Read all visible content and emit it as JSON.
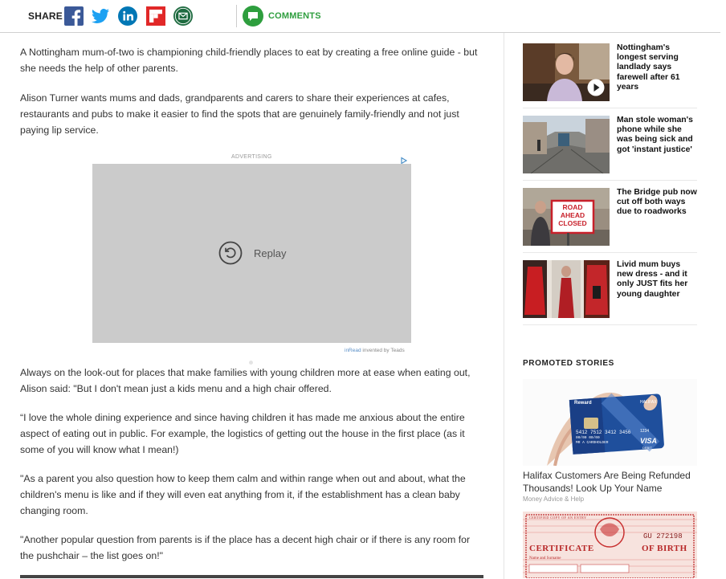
{
  "share": {
    "label": "SHARE",
    "icons": [
      "facebook-icon",
      "twitter-icon",
      "linkedin-icon",
      "flipboard-icon",
      "email-icon"
    ],
    "comments_label": "COMMENTS"
  },
  "article": {
    "paragraphs": [
      "A Nottingham mum-of-two is championing child-friendly places to eat by creating a free online guide - but she needs the help of other parents.",
      "Alison Turner wants mums and dads, grandparents and carers to share their experiences at cafes, restaurants and pubs to make it easier to find the spots that are genuinely family-friendly and not just paying lip service.",
      "Always on the look-out for places that make families with young children more at ease when eating out, Alison said: \"But I don't mean just a kids menu and a high chair offered.",
      "“I love the whole dining experience and since having children it has made me anxious about the entire aspect of eating out in public. For example, the logistics of getting out the house in the first place (as it some of you will know what I mean!)",
      "\"As a parent you also question how to keep them calm and within range when out and about, what the children's menu is like and if they will even eat anything from it, if the establishment has a clean baby changing room.",
      "\"Another popular question from parents is if the place has a decent high chair or if there is any room for the pushchair – the list goes on!\""
    ]
  },
  "ad": {
    "label": "ADVERTISING",
    "replay_label": "Replay",
    "credit_brand": "inRead",
    "credit_rest": " invented by Teads"
  },
  "sidebar": {
    "stories": [
      {
        "title": "Nottingham's longest serving landlady says farewell after 61 years",
        "has_video": true
      },
      {
        "title": "Man stole woman's phone while she was being sick and got 'instant justice'",
        "has_video": false
      },
      {
        "title": "The Bridge pub now cut off both ways due to roadworks",
        "has_video": false
      },
      {
        "title": "Livid mum buys new dress - and it only JUST fits her young daughter",
        "has_video": false
      }
    ],
    "road_sign_lines": [
      "ROAD",
      "AHEAD",
      "CLOSED"
    ],
    "promoted_label": "PROMOTED STORIES",
    "promo": {
      "title": "Halifax Customers Are Being Refunded Thousands! Look Up Your Name",
      "source": "Money Advice & Help",
      "card_lines": {
        "reward": "Reward",
        "brand": "HALIFAX",
        "number": "5412 7512 3412 3456",
        "valid": "00/00  00/00",
        "holder": "MR A CARDHOLDER",
        "digits": "1234",
        "network": "VISA",
        "debit": "DEBIT"
      }
    },
    "certificate": {
      "number": "GU 272198",
      "title_left": "CERTIFICATE",
      "title_right": "OF BIRTH",
      "header": "CERTIFIED COPY OF AN ENTRY",
      "field": "Name and Surname"
    }
  },
  "colors": {
    "facebook": "#3b5998",
    "twitter": "#1da1f2",
    "linkedin": "#0077b5",
    "flipboard": "#e12828",
    "email": "#1e6b40",
    "comments": "#2e9e3e"
  }
}
